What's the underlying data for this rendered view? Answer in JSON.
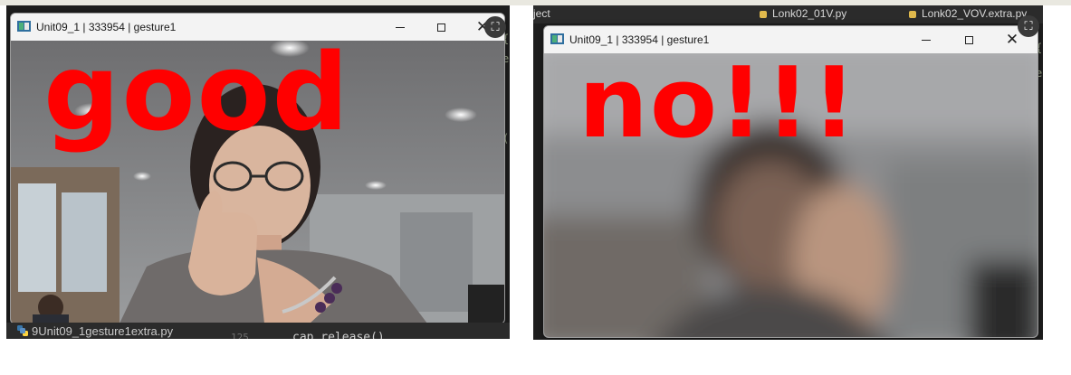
{
  "left": {
    "window": {
      "title": "Unit09_1 | 333954 | gesture1",
      "overlay_text": "good",
      "close_glyph": "✕"
    },
    "status_file": "9Unit09_1gesture1extra.py",
    "code_line_number": "125",
    "code_text": "cap.release()",
    "gutter_chars": [
      "{",
      "e",
      "(",
      "f",
      "e",
      "9",
      "="
    ]
  },
  "right": {
    "ide_tabs": [
      "ject",
      "Lonk02_01V.py",
      "Lonk02_VOV.extra.py"
    ],
    "window": {
      "title": "Unit09_1 | 333954 | gesture1",
      "overlay_text": "no!!!",
      "close_glyph": "✕"
    },
    "gutter_chars": [
      "{",
      "e",
      "(",
      "f",
      "e",
      "9",
      "="
    ]
  },
  "colors": {
    "overlay": "#ff0000",
    "titlebar": "#f3f3f3",
    "ide_dark": "#1e1e1e"
  },
  "icons": {
    "app": "opencv-window-icon",
    "snip": "snip-expand-icon",
    "python": "python-file-icon"
  }
}
